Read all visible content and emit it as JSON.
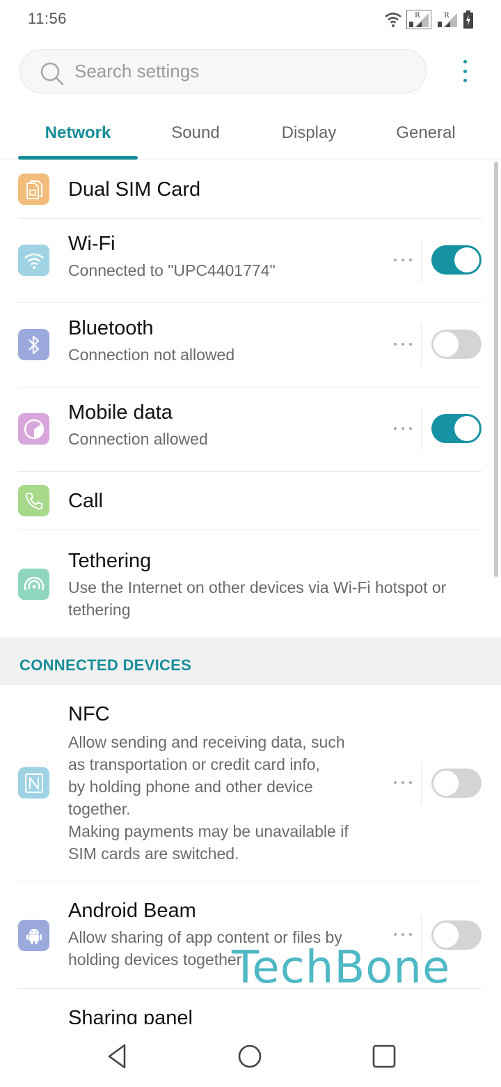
{
  "status_bar": {
    "time": "11:56",
    "icons": [
      "wifi-icon",
      "sim1-signal-roaming-icon",
      "sim2-signal-roaming-icon",
      "battery-charging-icon"
    ],
    "roaming_label": "R"
  },
  "search": {
    "placeholder": "Search settings",
    "value": ""
  },
  "tabs": [
    {
      "label": "Network",
      "active": true
    },
    {
      "label": "Sound",
      "active": false
    },
    {
      "label": "Display",
      "active": false
    },
    {
      "label": "General",
      "active": false
    }
  ],
  "network_items": [
    {
      "title": "Dual SIM Card",
      "subtitle": "",
      "icon": "sim-card-icon",
      "color": "#f2bd7a"
    },
    {
      "title": "Wi-Fi",
      "subtitle": "Connected to \"UPC4401774\"",
      "icon": "wifi-icon",
      "color": "#9fd3e3",
      "toggle": true
    },
    {
      "title": "Bluetooth",
      "subtitle": "Connection not allowed",
      "icon": "bluetooth-icon",
      "color": "#9ba9dd",
      "toggle": false
    },
    {
      "title": "Mobile data",
      "subtitle": "Connection allowed",
      "icon": "mobile-data-icon",
      "color": "#d8a6dc",
      "toggle": true
    },
    {
      "title": "Call",
      "subtitle": "",
      "icon": "phone-icon",
      "color": "#a7d98a"
    },
    {
      "title": "Tethering",
      "subtitle": "Use the Internet on other devices via Wi-Fi hotspot or tethering",
      "icon": "hotspot-icon",
      "color": "#8fd6bd"
    }
  ],
  "connected_devices": {
    "header": "CONNECTED DEVICES",
    "items": [
      {
        "title": "NFC",
        "subtitle_lines": [
          "Allow sending and receiving data, such",
          "as transportation or credit card info,",
          "by holding phone and other device",
          "together.",
          "Making payments may be unavailable if",
          "SIM cards are switched."
        ],
        "icon": "nfc-icon",
        "color": "#9fd3e3",
        "toggle": false
      },
      {
        "title": "Android Beam",
        "subtitle": "Allow sharing of app content or files by holding devices together",
        "icon": "android-icon",
        "color": "#9ba9dd",
        "toggle": false
      },
      {
        "title": "Sharing panel"
      }
    ]
  },
  "watermark": "TechBone",
  "nav_bar": {
    "buttons": [
      "back-button",
      "home-button",
      "recents-button"
    ]
  },
  "colors": {
    "accent": "#178e9a",
    "toggle_on": "#1592a3",
    "toggle_off": "#d4d4d4",
    "section_bg": "#f1f1f1"
  }
}
